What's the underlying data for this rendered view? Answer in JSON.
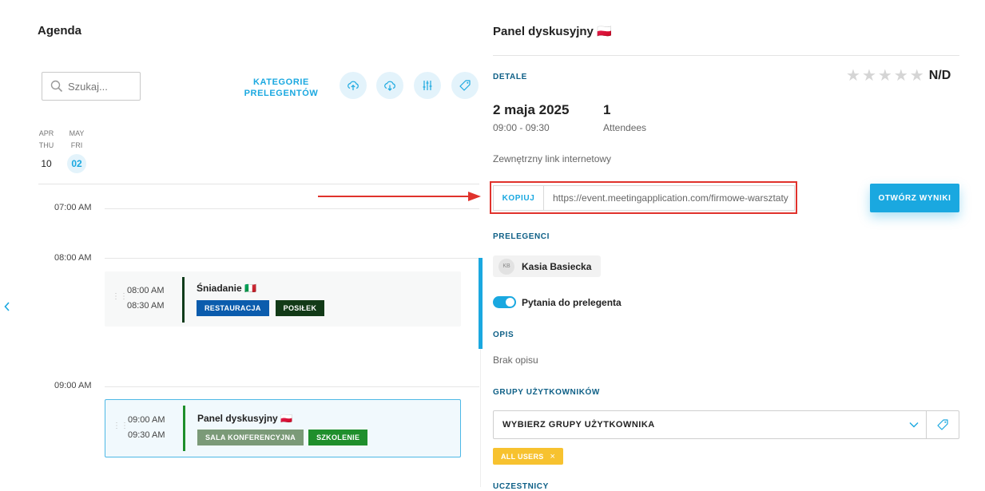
{
  "left": {
    "title": "Agenda",
    "search_placeholder": "Szukaj...",
    "speaker_categories_label_line1": "KATEGORIE",
    "speaker_categories_label_line2": "PRELEGENTÓW",
    "toolbar_icons": [
      "cloud-upload-icon",
      "cloud-download-icon",
      "sliders-icon",
      "tag-icon"
    ],
    "days": [
      {
        "month": "APR",
        "weekday": "THU",
        "day": "10",
        "selected": false
      },
      {
        "month": "MAY",
        "weekday": "FRI",
        "day": "02",
        "selected": true
      }
    ],
    "time_labels": [
      "07:00 AM",
      "08:00 AM",
      "09:00 AM"
    ],
    "events": [
      {
        "start": "08:00 AM",
        "end": "08:30 AM",
        "title": "Śniadanie 🇮🇹",
        "bar_color": "#0e3b1a",
        "tags": [
          {
            "label": "RESTAURACJA",
            "color": "#0b5cad"
          },
          {
            "label": "POSIŁEK",
            "color": "#123a17"
          }
        ]
      },
      {
        "start": "09:00 AM",
        "end": "09:30 AM",
        "title": "Panel dyskusyjny 🇵🇱",
        "bar_color": "#1f8f2c",
        "tags": [
          {
            "label": "SALA KONFERENCYJNA",
            "color": "#7b9a78"
          },
          {
            "label": "SZKOLENIE",
            "color": "#1f8f2c"
          }
        ]
      }
    ]
  },
  "right": {
    "title": "Panel dyskusyjny 🇵🇱",
    "details_label": "DETALE",
    "rating_text": "N/D",
    "rating_stars": 5,
    "date": "2 maja 2025",
    "time_range": "09:00 - 09:30",
    "attendee_count": "1",
    "attendee_label": "Attendees",
    "external_link_label": "Zewnętrzny link internetowy",
    "copy_label": "KOPIUJ",
    "url": "https://event.meetingapplication.com/firmowe-warsztaty",
    "open_results_label": "OTWÓRZ WYNIKI",
    "speakers_label": "PRELEGENCI",
    "speaker_initials": "KB",
    "speaker_name": "Kasia Basiecka",
    "questions_label": "Pytania do prelegenta",
    "questions_enabled": true,
    "description_label": "OPIS",
    "description": "Brak opisu",
    "user_groups_label": "GRUPY UŻYTKOWNIKÓW",
    "user_groups_placeholder": "WYBIERZ GRUPY UŻYTKOWNIKA",
    "selected_group": "ALL USERS",
    "next_section_label": "UCZESTNICY"
  },
  "colors": {
    "accent": "#1aa8e0",
    "section_label": "#0d5f86",
    "highlight_red": "#e0322c",
    "chip_yellow": "#f7c22f"
  }
}
